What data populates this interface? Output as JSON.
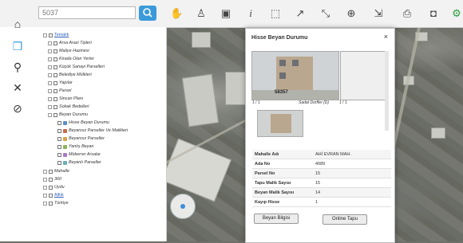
{
  "search": {
    "value": "5037"
  },
  "colors": {
    "accent": "#3b9ad9",
    "link": "#2b5db8",
    "photo_sky": "#c7c9c8"
  },
  "toolbar": {
    "tools": [
      "search-icon",
      "hand-pan-icon",
      "person-icon",
      "image-icon",
      "info-icon",
      "select-box-icon",
      "polyline-icon",
      "measure-icon",
      "globe-icon",
      "export-icon",
      "printer-icon",
      "camera-icon",
      "settings-icon"
    ]
  },
  "rail": {
    "icons": [
      "home-icon",
      "layers-icon",
      "search-icon",
      "tools-icon",
      "compass-icon"
    ]
  },
  "tree": {
    "nodes": [
      {
        "label": "Temalik",
        "level": 0,
        "link": true,
        "expanded": true
      },
      {
        "label": "Arsa Arazi Tipleri",
        "level": 1
      },
      {
        "label": "Maliye Hazinesi",
        "level": 1
      },
      {
        "label": "Kirada Olan Yerler",
        "level": 1
      },
      {
        "label": "Küçük Sanayi Parselleri",
        "level": 1
      },
      {
        "label": "Belediye Mülkleri",
        "level": 1
      },
      {
        "label": "Yapılar",
        "level": 1
      },
      {
        "label": "Parsel",
        "level": 1
      },
      {
        "label": "Sincan Planı",
        "level": 1
      },
      {
        "label": "Sokak Bedelleri",
        "level": 1
      },
      {
        "label": "Beyan Durumu",
        "level": 1,
        "expanded": true
      },
      {
        "label": "Hisse Beyan Durumu",
        "level": 2,
        "checked": true,
        "color": "#5b8ec8"
      },
      {
        "label": "Beyansız Parseller Ve Malikleri",
        "level": 2,
        "color": "#c86b4a"
      },
      {
        "label": "Beyansız Parseller",
        "level": 2,
        "color": "#d9a24a"
      },
      {
        "label": "Yanlış Beyan",
        "level": 2,
        "color": "#8fb35a"
      },
      {
        "label": "Mükerrer Arsalar",
        "level": 2,
        "color": "#a77bc4"
      },
      {
        "label": "Beyanlı Parseller",
        "level": 2,
        "color": "#6ab0b8"
      },
      {
        "label": "Mahalle",
        "level": 0
      },
      {
        "label": "360",
        "level": 0
      },
      {
        "label": "Uydu",
        "level": 0
      },
      {
        "label": "Altlık",
        "level": 0,
        "link": true
      },
      {
        "label": "Türkiye",
        "level": 0
      }
    ]
  },
  "popup": {
    "title": "Hisse Beyan Durumu",
    "close": "×",
    "photo_number": "58357",
    "pager_left": "1 / 1",
    "photo_caption": "Sadat Dorffer (D)",
    "pager_right": "1 / 1",
    "rows": [
      {
        "key": "Mahalle Adı",
        "value": "AHİ EVRAN MAH."
      },
      {
        "key": "Ada No",
        "value": "4089"
      },
      {
        "key": "Parsel No",
        "value": "15"
      },
      {
        "key": "Tapu Malik Sayısı",
        "value": "15"
      },
      {
        "key": "Beyan Malik Sayısı",
        "value": "14"
      },
      {
        "key": "Kayıp Hisse",
        "value": "1"
      }
    ],
    "buttons": {
      "declaration": "Beyan Bilgisi",
      "online_deed": "Online Tapu"
    }
  }
}
